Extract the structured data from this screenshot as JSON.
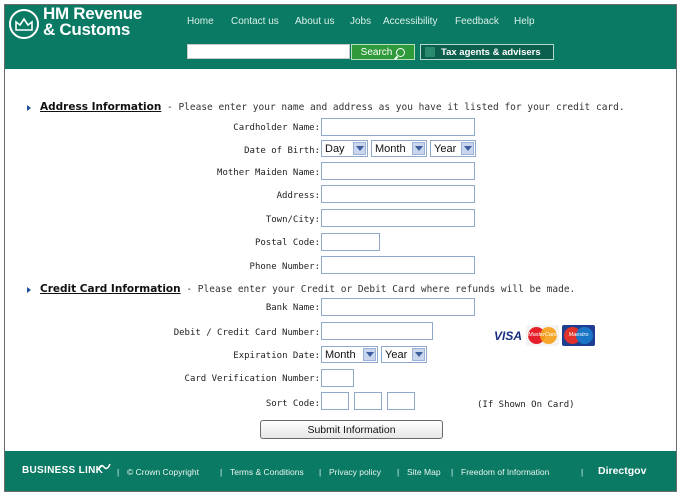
{
  "header": {
    "logo_line1": "HM Revenue",
    "logo_line2": "& Customs",
    "nav": [
      "Home",
      "Contact us",
      "About us",
      "Jobs",
      "Accessibility",
      "Feedback",
      "Help"
    ],
    "search_value": "",
    "search_button": "Search",
    "agents_button": "Tax agents & advisers",
    "color": "#0a7a64"
  },
  "address_section": {
    "title": "Address Information",
    "description": " - Please enter your name and address as you have it listed for your credit card.",
    "fields": {
      "cardholder_name": {
        "label": "Cardholder Name:",
        "value": ""
      },
      "date_of_birth": {
        "label": "Date of Birth:",
        "day": "Day",
        "month": "Month",
        "year": "Year"
      },
      "mother_maiden_name": {
        "label": "Mother Maiden Name:",
        "value": ""
      },
      "address": {
        "label": "Address:",
        "value": ""
      },
      "town_city": {
        "label": "Town/City:",
        "value": ""
      },
      "postal_code": {
        "label": "Postal Code:",
        "value": ""
      },
      "phone_number": {
        "label": "Phone Number:",
        "value": ""
      }
    }
  },
  "card_section": {
    "title": "Credit Card Information",
    "description": " - Please enter your Credit or Debit Card where refunds will be made.",
    "fields": {
      "bank_name": {
        "label": "Bank Name:",
        "value": ""
      },
      "card_number": {
        "label": "Debit / Credit Card Number:",
        "value": ""
      },
      "expiration_date": {
        "label": "Expiration Date:",
        "month": "Month",
        "year": "Year"
      },
      "cvn": {
        "label": "Card Verification Number:",
        "value": ""
      },
      "sort_code": {
        "label": "Sort Code:",
        "note": "(If Shown On Card)"
      }
    },
    "card_logos": {
      "visa": "VISA",
      "mastercard": "MasterCard",
      "maestro": "Maestro"
    }
  },
  "submit_label": "Submit Information",
  "footer": {
    "business_link": "BUSINESS LINK",
    "links": [
      "© Crown Copyright",
      "Terms & Conditions",
      "Privacy policy",
      "Site Map",
      "Freedom of Information"
    ],
    "directgov": "Directgov"
  }
}
